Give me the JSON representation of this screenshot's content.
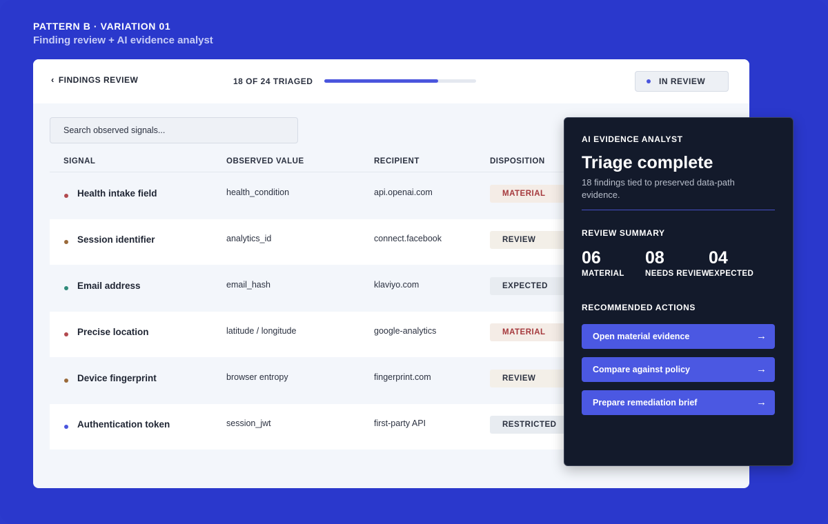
{
  "pattern": {
    "title": "PATTERN B · VARIATION 01",
    "subtitle": "Finding review + AI evidence analyst"
  },
  "header": {
    "back_label": "FINDINGS REVIEW",
    "triage_count": "18 OF 24 TRIAGED",
    "progress_fraction": 0.75,
    "status": "IN REVIEW"
  },
  "search": {
    "placeholder": "Search observed signals..."
  },
  "table": {
    "columns": [
      "SIGNAL",
      "OBSERVED VALUE",
      "RECIPIENT",
      "DISPOSITION"
    ],
    "rows": [
      {
        "signal": "Health intake field",
        "value": "health_condition",
        "recipient": "api.openai.com",
        "disposition": "MATERIAL",
        "dot_color": "#b24a4f"
      },
      {
        "signal": "Session identifier",
        "value": "analytics_id",
        "recipient": "connect.facebook",
        "disposition": "REVIEW",
        "dot_color": "#9a6a3a"
      },
      {
        "signal": "Email address",
        "value": "email_hash",
        "recipient": "klaviyo.com",
        "disposition": "EXPECTED",
        "dot_color": "#2f8a7a"
      },
      {
        "signal": "Precise location",
        "value": "latitude / longitude",
        "recipient": "google-analytics",
        "disposition": "MATERIAL",
        "dot_color": "#b24a4f"
      },
      {
        "signal": "Device fingerprint",
        "value": "browser entropy",
        "recipient": "fingerprint.com",
        "disposition": "REVIEW",
        "dot_color": "#9a6a3a"
      },
      {
        "signal": "Authentication token",
        "value": "session_jwt",
        "recipient": "first-party API",
        "disposition": "RESTRICTED",
        "dot_color": "#4a55dd"
      }
    ]
  },
  "analyst": {
    "kicker": "AI EVIDENCE ANALYST",
    "title": "Triage complete",
    "description": "18 findings tied to preserved data-path evidence.",
    "summary_label": "REVIEW SUMMARY",
    "stats": [
      {
        "num": "06",
        "label": "MATERIAL"
      },
      {
        "num": "08",
        "label": "NEEDS REVIEW"
      },
      {
        "num": "04",
        "label": "EXPECTED"
      }
    ],
    "actions_label": "RECOMMENDED ACTIONS",
    "actions": [
      "Open material evidence",
      "Compare against policy",
      "Prepare remediation brief"
    ]
  }
}
